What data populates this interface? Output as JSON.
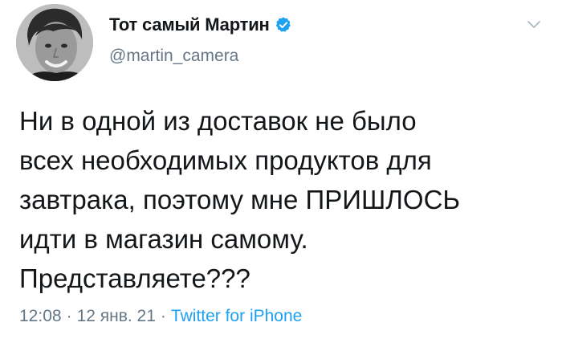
{
  "author": {
    "display_name": "Тот самый Мартин",
    "handle": "@martin_camera",
    "avatar_icon": "profile-photo",
    "verified_icon": "verified-badge-icon",
    "verified_color": "#1da1f2"
  },
  "tweet": {
    "lines": [
      "Ни в одной из доставок не было",
      "всех необходимых продуктов для",
      "завтрака, поэтому мне ПРИШЛОСЬ",
      "идти в магазин самому.",
      "Представляете???"
    ]
  },
  "meta": {
    "time": "12:08",
    "date": "12 янв. 21",
    "separator": "·",
    "source": "Twitter for iPhone"
  },
  "menu_icon": "chevron-down-icon",
  "colors": {
    "text": "#14171a",
    "secondary": "#657786",
    "link": "#1da1f2"
  }
}
